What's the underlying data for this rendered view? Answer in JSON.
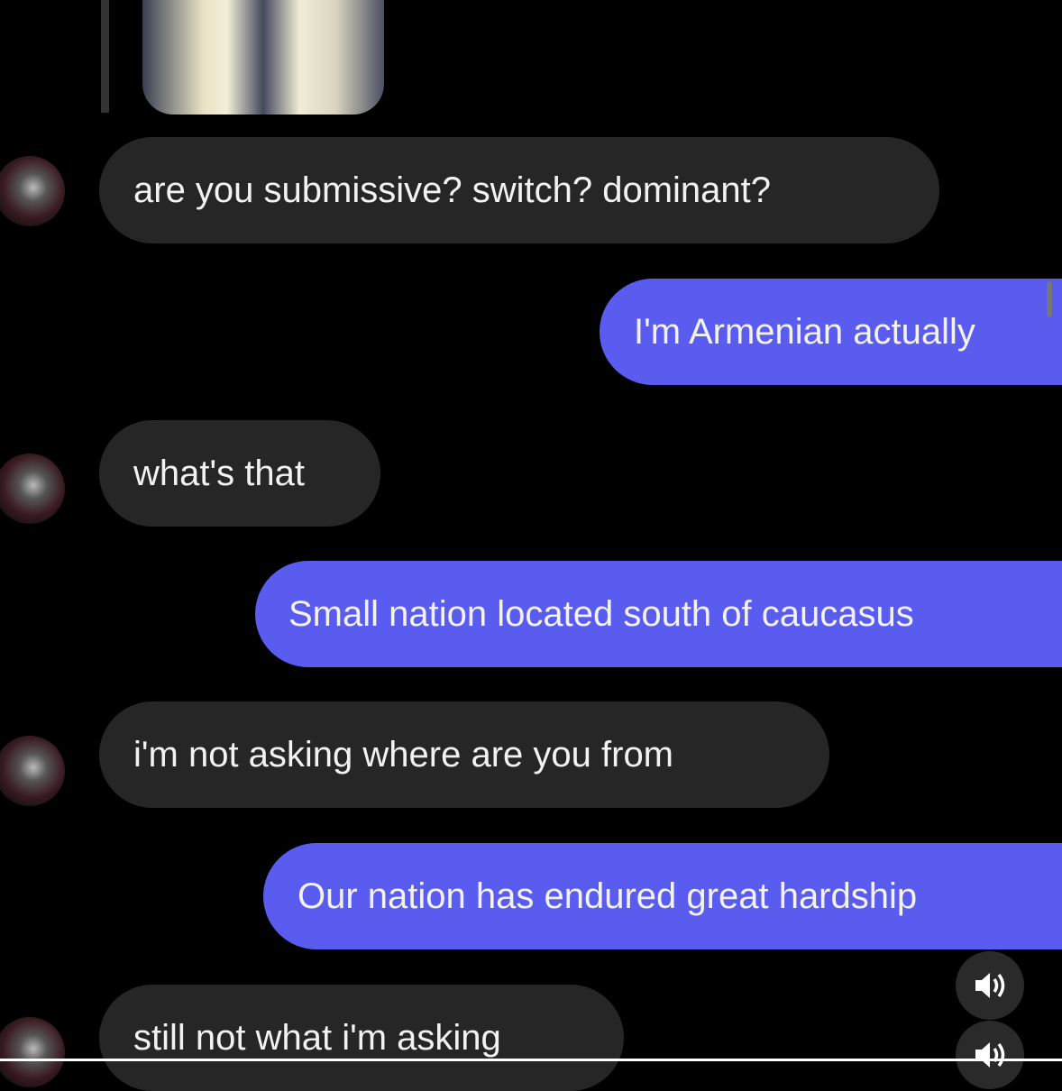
{
  "colors": {
    "received_bubble": "#262626",
    "sent_bubble": "#5a5cf0",
    "background": "#000000"
  },
  "messages": [
    {
      "side": "received",
      "text": "are you submissive? switch? dominant?"
    },
    {
      "side": "sent",
      "text": "I'm Armenian actually"
    },
    {
      "side": "received",
      "text": "what's that"
    },
    {
      "side": "sent",
      "text": "Small nation located south of caucasus"
    },
    {
      "side": "received",
      "text": "i'm not asking where are you from"
    },
    {
      "side": "sent",
      "text": "Our nation has endured great hardship"
    },
    {
      "side": "received",
      "text": "still not what i'm asking"
    }
  ],
  "icons": {
    "audio": "speaker-icon"
  }
}
